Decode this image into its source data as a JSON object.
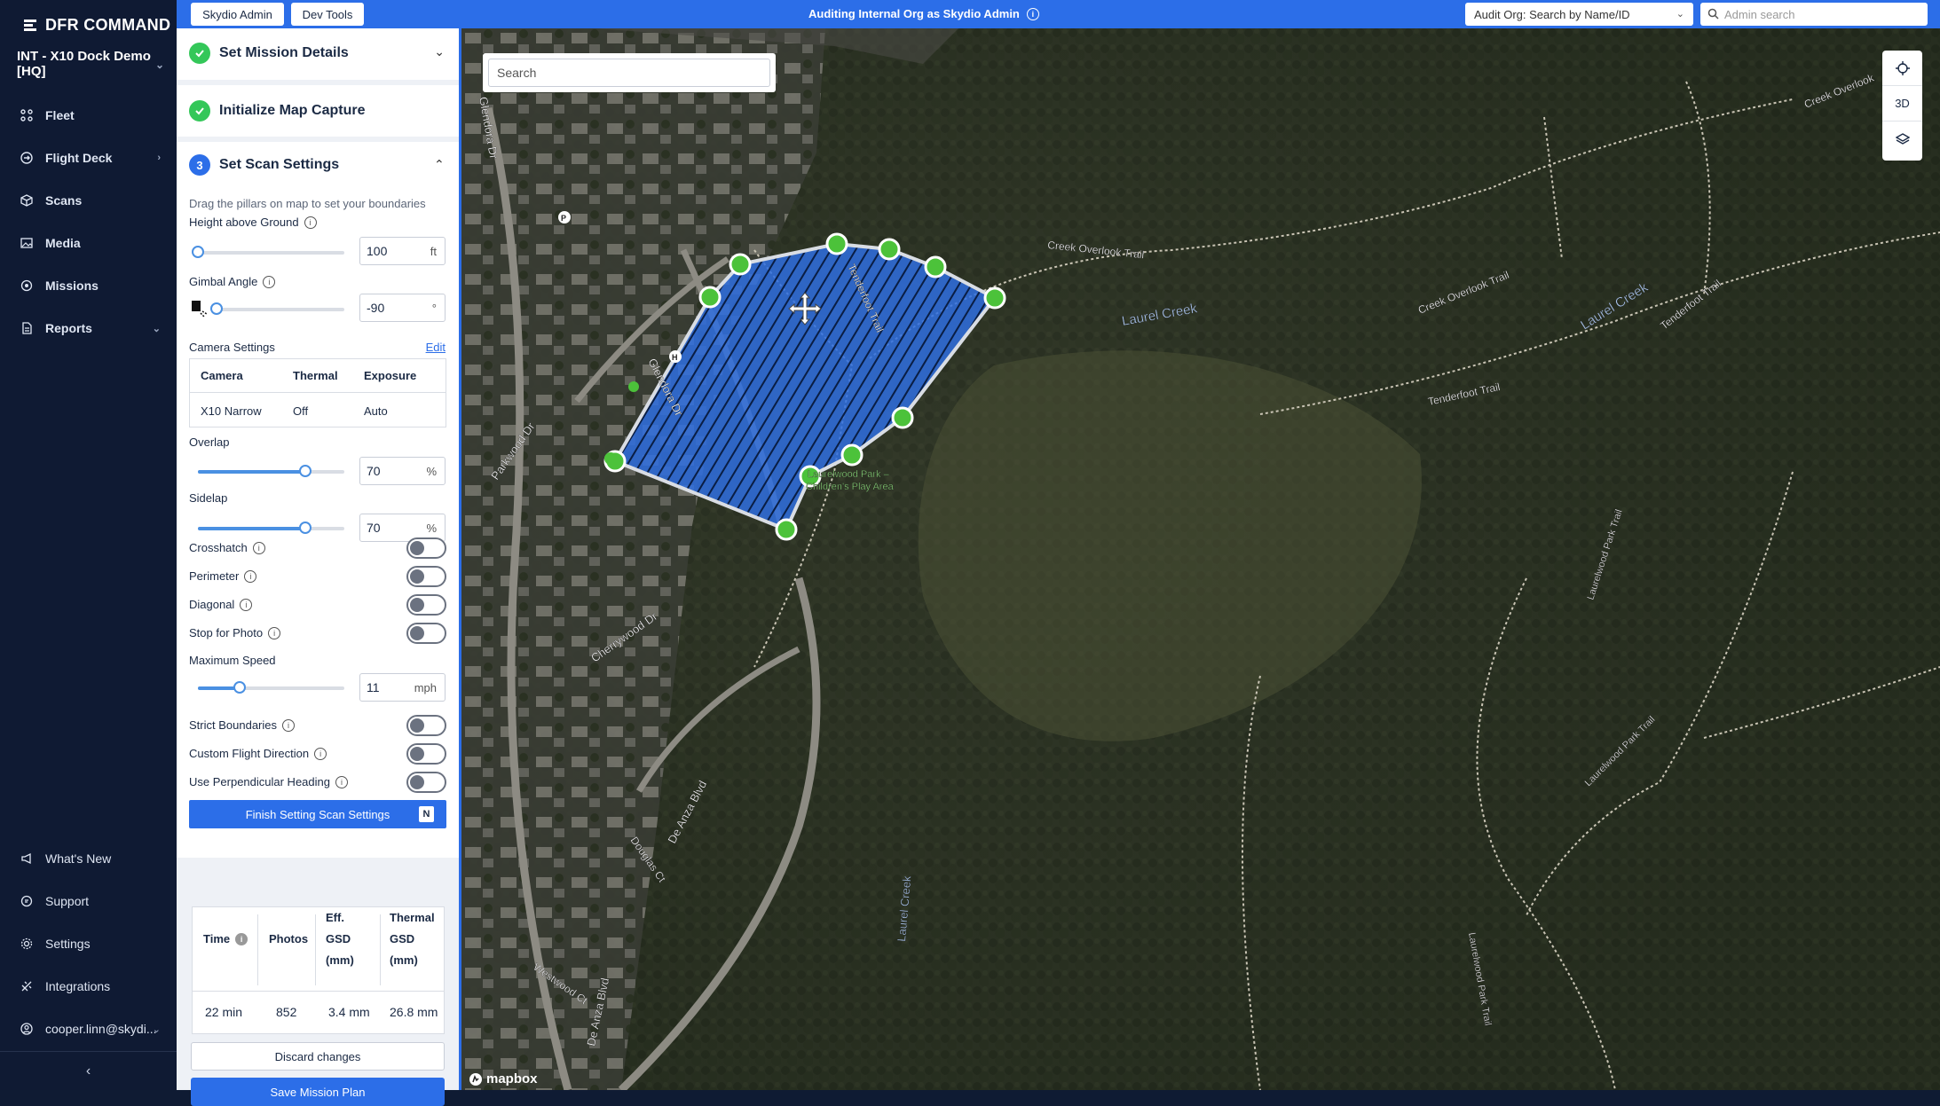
{
  "brand": {
    "name": "DFR COMMAND"
  },
  "org": {
    "name": "INT - X10 Dock Demo [HQ]"
  },
  "nav": {
    "items": [
      {
        "label": "Fleet",
        "icon": "fleet-icon"
      },
      {
        "label": "Flight Deck",
        "icon": "flight-deck-icon"
      },
      {
        "label": "Scans",
        "icon": "cube-icon"
      },
      {
        "label": "Media",
        "icon": "image-icon"
      },
      {
        "label": "Missions",
        "icon": "mission-icon"
      },
      {
        "label": "Reports",
        "icon": "report-icon"
      }
    ],
    "bottom": [
      {
        "label": "What's New",
        "icon": "megaphone-icon"
      },
      {
        "label": "Support",
        "icon": "chat-icon"
      },
      {
        "label": "Settings",
        "icon": "gear-icon"
      },
      {
        "label": "Integrations",
        "icon": "plug-icon"
      },
      {
        "label": "cooper.linn@skydi...",
        "icon": "user-icon"
      }
    ]
  },
  "topbar": {
    "skydio_admin": "Skydio Admin",
    "dev_tools": "Dev Tools",
    "audit_text": "Auditing Internal Org as Skydio Admin",
    "audit_org_placeholder": "Audit Org: Search by Name/ID",
    "admin_search_placeholder": "Admin search"
  },
  "steps": {
    "step1": "Set Mission Details",
    "step2": "Initialize Map Capture",
    "step3_num": "3",
    "step3": "Set Scan Settings"
  },
  "scan": {
    "hint": "Drag the pillars on map to set your boundaries",
    "height_label": "Height above Ground",
    "height_value": "100",
    "height_unit": "ft",
    "gimbal_label": "Gimbal Angle",
    "gimbal_value": "-90",
    "gimbal_unit": "°",
    "camera_settings_label": "Camera Settings",
    "edit_label": "Edit",
    "camera_headers": [
      "Camera",
      "Thermal",
      "Exposure"
    ],
    "camera_values": [
      "X10 Narrow",
      "Off",
      "Auto"
    ],
    "overlap_label": "Overlap",
    "overlap_value": "70",
    "overlap_unit": "%",
    "sidelap_label": "Sidelap",
    "sidelap_value": "70",
    "sidelap_unit": "%",
    "crosshatch_label": "Crosshatch",
    "perimeter_label": "Perimeter",
    "diagonal_label": "Diagonal",
    "stop_photo_label": "Stop for Photo",
    "max_speed_label": "Maximum Speed",
    "max_speed_value": "11",
    "max_speed_unit": "mph",
    "strict_label": "Strict Boundaries",
    "custom_dir_label": "Custom Flight Direction",
    "perp_label": "Use Perpendicular Heading",
    "finish_label": "Finish Setting Scan Settings",
    "finish_key": "N"
  },
  "stats": {
    "headers": {
      "time": "Time",
      "photos": "Photos",
      "eff_gsd": [
        "Eff.",
        "GSD",
        "(mm)"
      ],
      "thermal_gsd": [
        "Thermal",
        "GSD",
        "(mm)"
      ]
    },
    "time": "22 min",
    "photos": "852",
    "eff_gsd": "3.4 mm",
    "thermal_gsd": "26.8 mm"
  },
  "actions": {
    "discard": "Discard changes",
    "save": "Save Mission Plan"
  },
  "map": {
    "search_placeholder": "Search",
    "ctrl_3d": "3D",
    "attribution": "mapbox",
    "labels": {
      "creek_overlook_trail": "Creek Overlook Trail",
      "creek_overlook_trail2": "Creek Overlook Trail",
      "tenderfoot_trail": "Tenderfoot Trail",
      "tenderfoot_trail2": "Tenderfoot Trail",
      "tenderfoot_trail3": "Tenderfoot Trail",
      "laurel_creek": "Laurel Creek",
      "laurel_creek2": "Laurel Creek",
      "laurel_creek3": "Laurel Creek",
      "park_line1": "Laurelwood Park –",
      "park_line2": "Children's Play Area",
      "glendora_dr": "Glendora Dr",
      "glendora_dr2": "Glendora Dr",
      "parkwood_dr": "Parkwood Dr",
      "cherrywood_dr": "Cherrywood Dr",
      "de_anza_blvd": "De Anza Blvd",
      "de_anza_blvd2": "De Anza Blvd",
      "douglas_ct": "Douglas Ct",
      "westwood_ct": "Westwood Ct",
      "laurelwood_park_trail": "Laurelwood Park Trail",
      "laurelwood_park_trail2": "Laurelwood Park Trail",
      "laurelwood_park_trail3": "Laurelwood Park Trail",
      "creek_overlook_corner": "Creek Overlook"
    }
  },
  "colors": {
    "accent": "#2c6ee8",
    "sidebar": "#0f1a33",
    "vertex": "#4cc23a",
    "scan_fill": "#2f6fe0"
  }
}
